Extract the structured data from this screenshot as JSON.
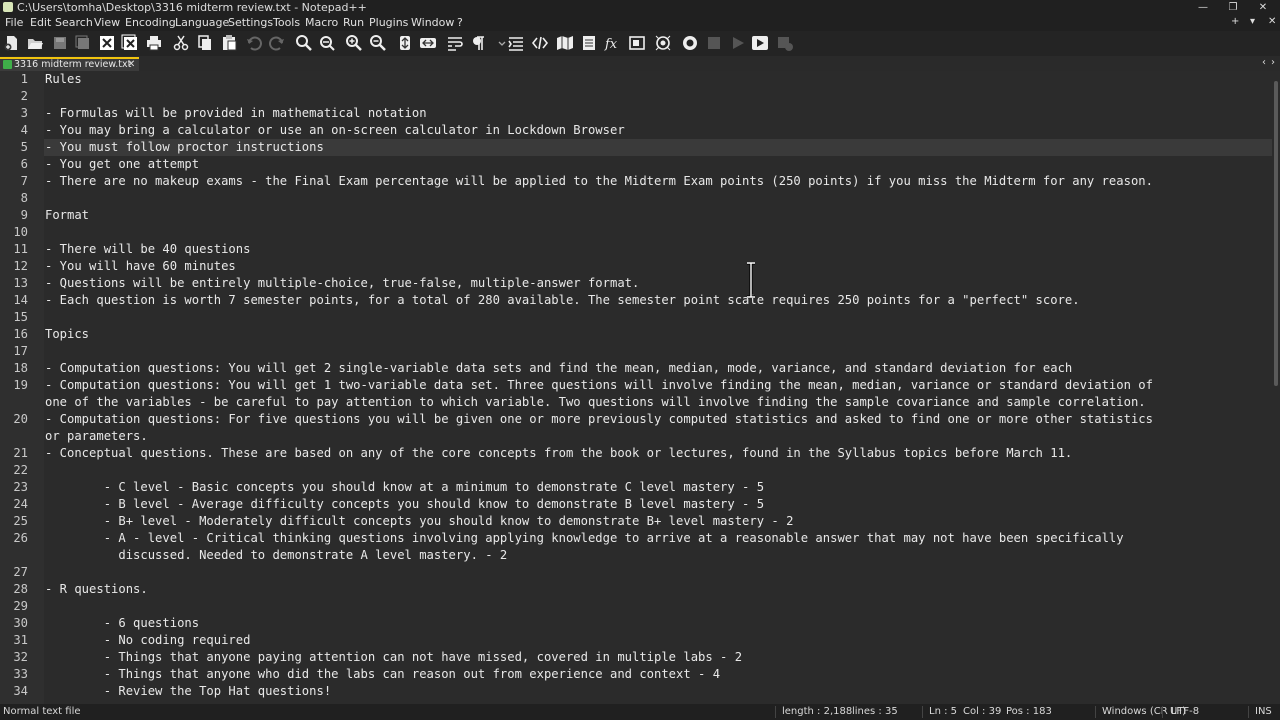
{
  "window": {
    "title": "C:\\Users\\tomha\\Desktop\\3316 midterm review.txt - Notepad++"
  },
  "menu": [
    "File",
    "Edit",
    "Search",
    "View",
    "Encoding",
    "Language",
    "Settings",
    "Tools",
    "Macro",
    "Run",
    "Plugins",
    "Window",
    "?"
  ],
  "toolbar_icons": [
    "new-file-icon",
    "open-file-icon",
    "save-icon",
    "save-all-icon",
    "close-icon",
    "close-all-icon",
    "print-icon",
    "cut-icon",
    "copy-icon",
    "paste-icon",
    "undo-icon",
    "redo-icon",
    "find-icon",
    "replace-icon",
    "zoom-in-icon",
    "zoom-out-icon",
    "sync-v-icon",
    "sync-h-icon",
    "word-wrap-icon",
    "show-all-chars-icon",
    "indent-guide-icon",
    "udl-icon",
    "doc-map-icon",
    "doc-list-icon",
    "function-list-icon",
    "folder-workspace-icon",
    "monitoring-icon",
    "record-macro-icon",
    "stop-macro-icon",
    "play-macro-icon",
    "run-macro-multiple-icon",
    "save-macro-icon"
  ],
  "tab": {
    "label": "3316 midterm review.txt"
  },
  "lines": [
    {
      "n": "1",
      "text": "Rules"
    },
    {
      "n": "2",
      "text": ""
    },
    {
      "n": "3",
      "text": "- Formulas will be provided in mathematical notation"
    },
    {
      "n": "4",
      "text": "- You may bring a calculator or use an on-screen calculator in Lockdown Browser"
    },
    {
      "n": "5",
      "text": "- You must follow proctor instructions"
    },
    {
      "n": "6",
      "text": "- You get one attempt"
    },
    {
      "n": "7",
      "text": "- There are no makeup exams - the Final Exam percentage will be applied to the Midterm Exam points (250 points) if you miss the Midterm for any reason."
    },
    {
      "n": "8",
      "text": ""
    },
    {
      "n": "9",
      "text": "Format"
    },
    {
      "n": "10",
      "text": ""
    },
    {
      "n": "11",
      "text": "- There will be 40 questions"
    },
    {
      "n": "12",
      "text": "- You will have 60 minutes"
    },
    {
      "n": "13",
      "text": "- Questions will be entirely multiple-choice, true-false, multiple-answer format."
    },
    {
      "n": "14",
      "text": "- Each question is worth 7 semester points, for a total of 280 available. The semester point scale requires 250 points for a \"perfect\" score."
    },
    {
      "n": "15",
      "text": ""
    },
    {
      "n": "16",
      "text": "Topics"
    },
    {
      "n": "17",
      "text": ""
    },
    {
      "n": "18",
      "text": "- Computation questions: You will get 2 single-variable data sets and find the mean, median, mode, variance, and standard deviation for each"
    },
    {
      "n": "19",
      "text": "- Computation questions: You will get 1 two-variable data set. Three questions will involve finding the mean, median, variance or standard deviation of"
    },
    {
      "n": "",
      "text": "one of the variables - be careful to pay attention to which variable. Two questions will involve finding the sample covariance and sample correlation."
    },
    {
      "n": "20",
      "text": "- Computation questions: For five questions you will be given one or more previously computed statistics and asked to find one or more other statistics"
    },
    {
      "n": "",
      "text": "or parameters."
    },
    {
      "n": "21",
      "text": "- Conceptual questions. These are based on any of the core concepts from the book or lectures, found in the Syllabus topics before March 11."
    },
    {
      "n": "22",
      "text": ""
    },
    {
      "n": "23",
      "text": "        - C level - Basic concepts you should know at a minimum to demonstrate C level mastery - 5"
    },
    {
      "n": "24",
      "text": "        - B level - Average difficulty concepts you should know to demonstrate B level mastery - 5"
    },
    {
      "n": "25",
      "text": "        - B+ level - Moderately difficult concepts you should know to demonstrate B+ level mastery - 2"
    },
    {
      "n": "26",
      "text": "        - A - level - Critical thinking questions involving applying knowledge to arrive at a reasonable answer that may not have been specifically"
    },
    {
      "n": "",
      "text": "          discussed. Needed to demonstrate A level mastery. - 2"
    },
    {
      "n": "27",
      "text": ""
    },
    {
      "n": "28",
      "text": "- R questions."
    },
    {
      "n": "29",
      "text": ""
    },
    {
      "n": "30",
      "text": "        - 6 questions"
    },
    {
      "n": "31",
      "text": "        - No coding required"
    },
    {
      "n": "32",
      "text": "        - Things that anyone paying attention can not have missed, covered in multiple labs - 2"
    },
    {
      "n": "33",
      "text": "        - Things that anyone who did the labs can reason out from experience and context - 4"
    },
    {
      "n": "34",
      "text": "        - Review the Top Hat questions!"
    }
  ],
  "current_line_index": 4,
  "status": {
    "filetype": "Normal text file",
    "length": "length : 2,188",
    "lines": "lines : 35",
    "ln": "Ln : 5",
    "col": "Col : 39",
    "pos": "Pos : 183",
    "eol": "Windows (CR LF)",
    "encoding": "UTF-8",
    "mode": "INS"
  }
}
